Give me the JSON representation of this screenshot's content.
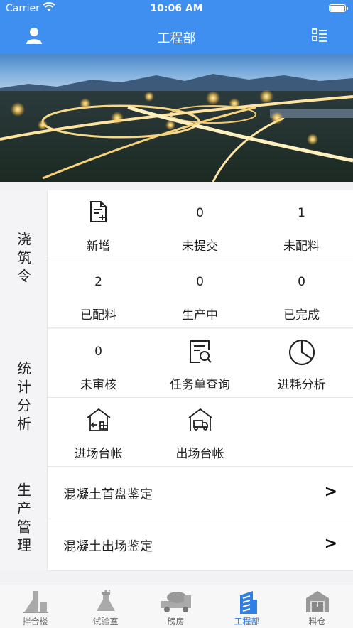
{
  "status_bar": {
    "carrier": "Carrier",
    "time": "10:06 AM"
  },
  "nav": {
    "title": "工程部"
  },
  "pour_order": {
    "label": "浇筑令",
    "row1": [
      {
        "top": "",
        "label": "新增"
      },
      {
        "top": "0",
        "label": "未提交"
      },
      {
        "top": "1",
        "label": "未配料"
      }
    ],
    "row2": [
      {
        "top": "2",
        "label": "已配料"
      },
      {
        "top": "0",
        "label": "生产中"
      },
      {
        "top": "0",
        "label": "已完成"
      }
    ]
  },
  "stats": {
    "label": "统计分析",
    "row1": [
      {
        "top": "0",
        "label": "未审核"
      },
      {
        "top": "",
        "label": "任务单查询"
      },
      {
        "top": "",
        "label": "进耗分析"
      }
    ],
    "row2": [
      {
        "label": "进场台帐"
      },
      {
        "label": "出场台帐"
      }
    ]
  },
  "production": {
    "label": "生产管理",
    "items": [
      {
        "label": "混凝土首盘鉴定",
        "arrow": ">"
      },
      {
        "label": "混凝土出场鉴定",
        "arrow": ">"
      }
    ]
  },
  "tabs": [
    {
      "label": "拌合楼",
      "icon": "mixing-tower-icon"
    },
    {
      "label": "试验室",
      "icon": "flask-icon"
    },
    {
      "label": "磅房",
      "icon": "mixer-truck-icon"
    },
    {
      "label": "工程部",
      "icon": "building-icon",
      "active": true
    },
    {
      "label": "料仓",
      "icon": "warehouse-icon"
    }
  ],
  "colors": {
    "primary": "#3f8ff0",
    "active_tab": "#2f7fe6"
  }
}
